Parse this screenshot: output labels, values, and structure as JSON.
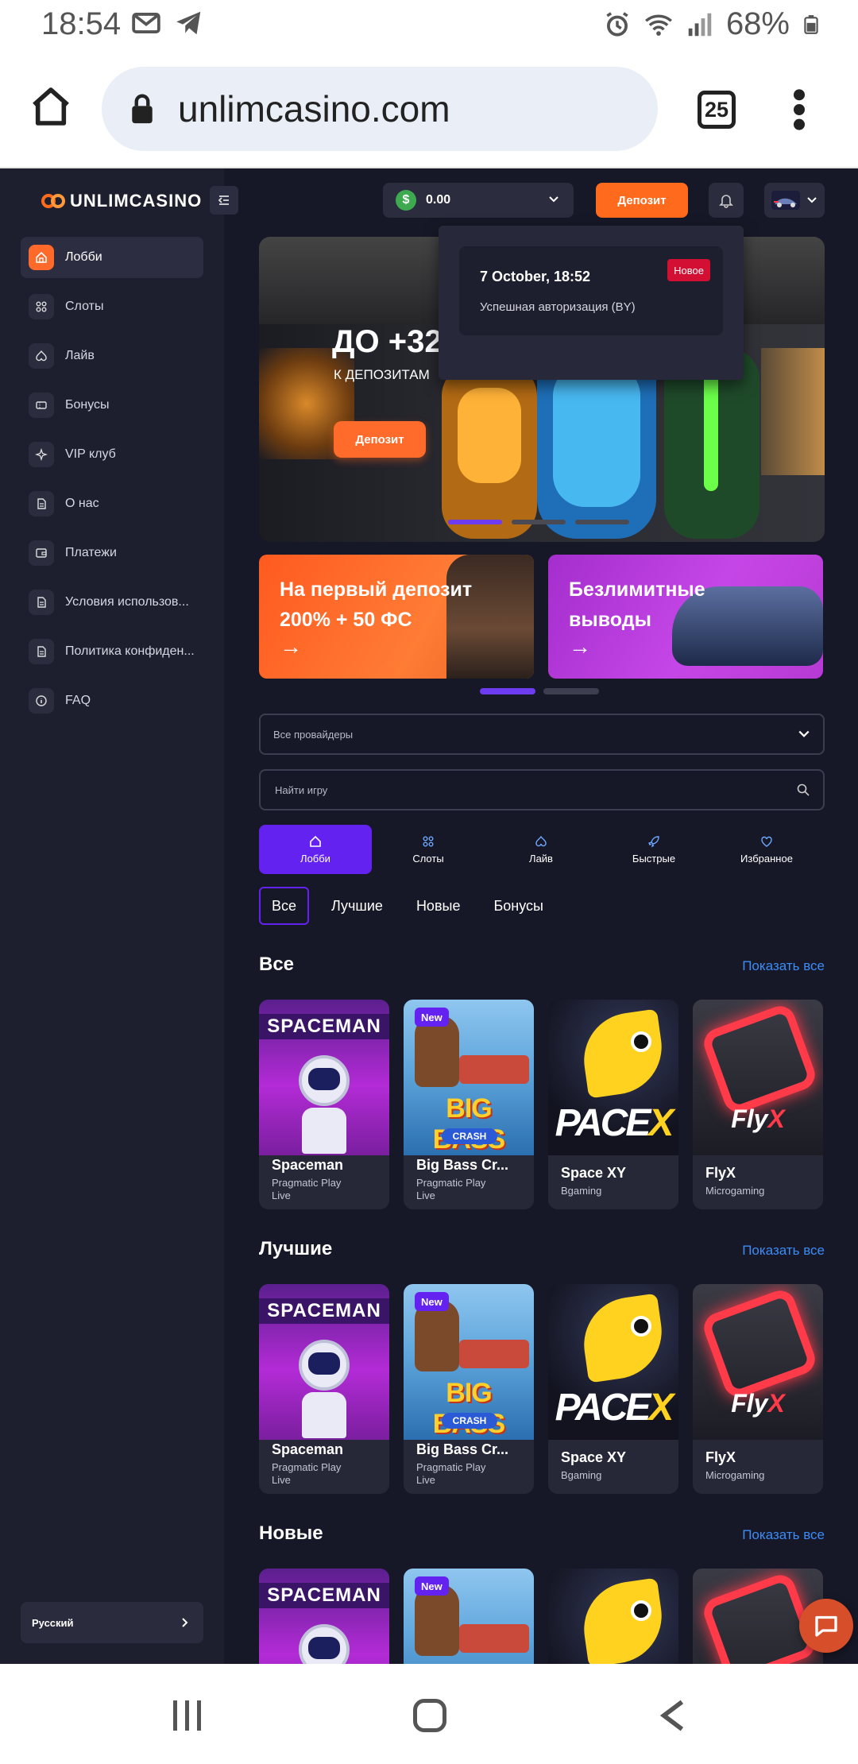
{
  "status_bar": {
    "time": "18:54",
    "battery": "68%"
  },
  "browser": {
    "url": "unlimcasino.com",
    "tab_count": "25"
  },
  "brand": {
    "logo_text": "UNLIMCASINO",
    "accent_color": "#ff6a1c",
    "primary_color": "#6322ef"
  },
  "sidebar": {
    "items": [
      {
        "label": "Лобби",
        "icon": "home-icon"
      },
      {
        "label": "Слоты",
        "icon": "grid-icon"
      },
      {
        "label": "Лайв",
        "icon": "spade-icon"
      },
      {
        "label": "Бонусы",
        "icon": "ticket-icon"
      },
      {
        "label": "VIP клуб",
        "icon": "sparkle-icon"
      },
      {
        "label": "О нас",
        "icon": "document-icon"
      },
      {
        "label": "Платежи",
        "icon": "wallet-icon"
      },
      {
        "label": "Условия использов...",
        "icon": "document-icon"
      },
      {
        "label": "Политика конфиден...",
        "icon": "document-icon"
      },
      {
        "label": "FAQ",
        "icon": "info-icon"
      }
    ],
    "language": "Русский"
  },
  "topbar": {
    "balance": "0.00",
    "deposit_label": "Депозит"
  },
  "notification": {
    "date": "7 October, 18:52",
    "badge": "Новое",
    "text": "Успешная авторизация (BY)"
  },
  "hero": {
    "title": "ДО +325",
    "subtitle": "К ДЕПОЗИТАМ",
    "cta": "Депозит"
  },
  "promos": [
    {
      "line1": "На первый депозит",
      "line2": "200% + 50 ФС",
      "arrow": "→"
    },
    {
      "line1": "Безлимитные",
      "line2": "выводы",
      "arrow": "→"
    }
  ],
  "filters": {
    "providers_placeholder": "Все провайдеры",
    "search_placeholder": "Найти игру"
  },
  "category_tabs": [
    {
      "label": "Лобби",
      "icon": "home-icon"
    },
    {
      "label": "Слоты",
      "icon": "grid-icon"
    },
    {
      "label": "Лайв",
      "icon": "spade-icon"
    },
    {
      "label": "Быстрые",
      "icon": "rocket-icon"
    },
    {
      "label": "Избранное",
      "icon": "heart-icon"
    }
  ],
  "sub_tabs": [
    "Все",
    "Лучшие",
    "Новые",
    "Бонусы"
  ],
  "sections": [
    {
      "title": "Все",
      "show_all": "Показать все"
    },
    {
      "title": "Лучшие",
      "show_all": "Показать все"
    },
    {
      "title": "Новые",
      "show_all": "Показать все"
    }
  ],
  "games": [
    {
      "name": "Spaceman",
      "provider": "Pragmatic Play",
      "extra": "Live",
      "thumb_text": "SPACEMAN"
    },
    {
      "name": "Big Bass Cr...",
      "provider": "Pragmatic Play",
      "extra": "Live",
      "badge": "New",
      "thumb_text": "BIG BASS",
      "thumb_sub": "CRASH"
    },
    {
      "name": "Space XY",
      "provider": "Bgaming",
      "thumb_text": "PACE",
      "thumb_x": "X"
    },
    {
      "name": "FlyX",
      "provider": "Microgaming",
      "thumb_text": "Fly",
      "thumb_x": "X"
    }
  ]
}
